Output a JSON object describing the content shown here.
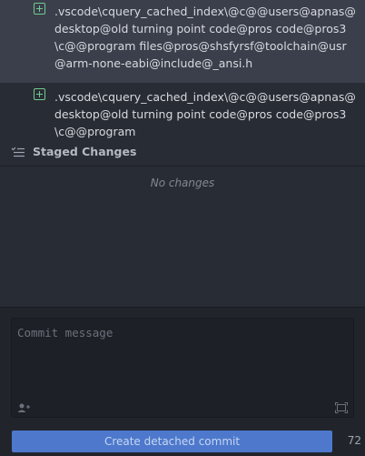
{
  "unstaged": {
    "items": [
      {
        "path": ".vscode\\cquery_cached_index\\@c@@users@apnas@desktop@old turning point code@pros code@pros3\\c@@program files@pros@shsfyrsf@toolchain@usr@arm-none-eabi@include@_ansi.h",
        "status_icon": "added-icon",
        "selected": true
      },
      {
        "path": ".vscode\\cquery_cached_index\\@c@@users@apnas@desktop@old turning point code@pros code@pros3\\c@@program",
        "status_icon": "added-icon",
        "selected": false
      }
    ]
  },
  "staged": {
    "title": "Staged Changes",
    "empty_text": "No changes",
    "icon": "list-check-icon"
  },
  "commit": {
    "placeholder": "Commit message",
    "value": "",
    "button_label": "Create detached commit",
    "remaining_chars": "72",
    "coauthor_icon": "person-add-icon",
    "expand_icon": "expand-icon"
  },
  "colors": {
    "background": "#282c34",
    "selected_row": "#3a3f4b",
    "added": "#73c990",
    "button": "#4d78cc"
  }
}
